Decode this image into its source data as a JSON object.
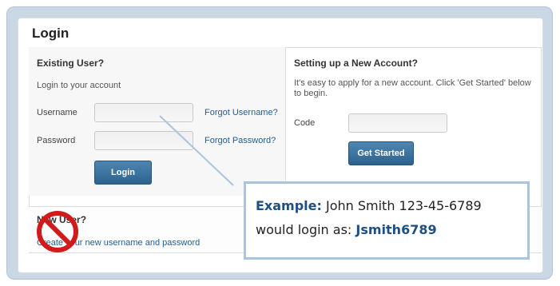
{
  "login": {
    "title": "Login"
  },
  "existing_user": {
    "heading": "Existing User?",
    "subtitle": "Login to your account",
    "username_label": "Username",
    "username_value": "",
    "password_label": "Password",
    "password_value": "",
    "forgot_username": "Forgot Username?",
    "forgot_password": "Forgot Password?",
    "login_button": "Login"
  },
  "new_account": {
    "heading": "Setting up a New Account?",
    "description": "It's easy to apply for a new account. Click 'Get Started' below to begin.",
    "code_label": "Code",
    "code_value": "",
    "get_started_button": "Get Started"
  },
  "new_user": {
    "heading": "New User?",
    "create_link": "Create your new username and password"
  },
  "callout": {
    "label": "Example:",
    "text1": " John Smith 123-45-6789",
    "text2": "would login as: ",
    "example_login": "Jsmith6789"
  },
  "colors": {
    "accent": "#2d628f",
    "callout_border": "#a9c4de",
    "no_symbol": "#d11a1a"
  },
  "icons": {
    "prohibition": "prohibition-icon"
  }
}
